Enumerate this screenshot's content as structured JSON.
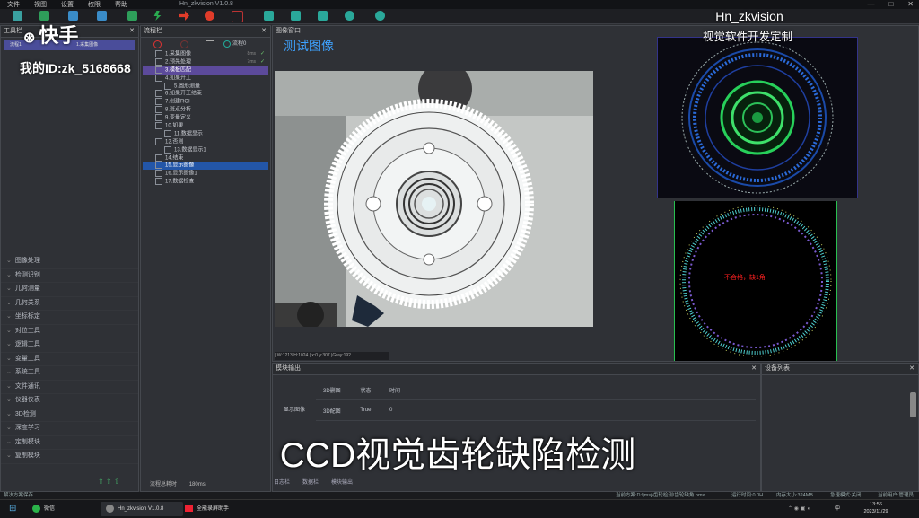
{
  "menubar": {
    "items": [
      "文件",
      "视图",
      "设置",
      "权限",
      "帮助"
    ],
    "title": "Hn_zkvision V1.0.8",
    "controls": [
      "—",
      "□",
      "✕"
    ]
  },
  "watermark": {
    "logo_text": "快手",
    "user_id": "我的ID:zk_5168668",
    "brand": "Hn_zkvision",
    "tagline": "视觉软件开发定制"
  },
  "toolbox": {
    "title": "工具栏",
    "top_item": "流程1",
    "top_item_right": "1.采集图像",
    "categories": [
      "图像处理",
      "检测识别",
      "几何测量",
      "几何关系",
      "坐标标定",
      "对位工具",
      "逻辑工具",
      "变量工具",
      "系统工具",
      "文件通讯",
      "仪器仪表",
      "3D检测",
      "深度学习",
      "定制模块",
      "复制模块"
    ]
  },
  "flow": {
    "title": "流程栏",
    "flow_name": "流程0",
    "rows": [
      {
        "label": "1.采集图像",
        "time": "8ms",
        "check": "✓",
        "style": "",
        "indent": 0
      },
      {
        "label": "2.预先处理",
        "time": "7ms",
        "check": "✓",
        "style": "",
        "indent": 0
      },
      {
        "label": "3.模板匹配",
        "time": "",
        "check": "",
        "style": "sel-purple",
        "indent": 0
      },
      {
        "label": "4.如果开工",
        "time": "",
        "check": "",
        "style": "",
        "indent": 0
      },
      {
        "label": "5.圆形测量",
        "time": "",
        "check": "",
        "style": "",
        "indent": 1
      },
      {
        "label": "6.如果开工结束",
        "time": "",
        "check": "",
        "style": "",
        "indent": 0
      },
      {
        "label": "7.创建ROI",
        "time": "",
        "check": "",
        "style": "",
        "indent": 0
      },
      {
        "label": "8.斑点分析",
        "time": "",
        "check": "",
        "style": "",
        "indent": 0
      },
      {
        "label": "9.变量定义",
        "time": "",
        "check": "",
        "style": "",
        "indent": 0
      },
      {
        "label": "10.如果",
        "time": "",
        "check": "",
        "style": "",
        "indent": 0
      },
      {
        "label": "11.数据显示",
        "time": "",
        "check": "",
        "style": "",
        "indent": 1
      },
      {
        "label": "12.否则",
        "time": "",
        "check": "",
        "style": "",
        "indent": 0
      },
      {
        "label": "13.数据显示1",
        "time": "",
        "check": "",
        "style": "",
        "indent": 1
      },
      {
        "label": "14.结束",
        "time": "",
        "check": "",
        "style": "",
        "indent": 0
      },
      {
        "label": "15.显示图像",
        "time": "",
        "check": "",
        "style": "sel-blue",
        "indent": 0
      },
      {
        "label": "16.显示图像1",
        "time": "",
        "check": "",
        "style": "",
        "indent": 0
      },
      {
        "label": "17.数据检查",
        "time": "",
        "check": "",
        "style": "",
        "indent": 0
      }
    ],
    "total_label": "流程总耗时",
    "total_value": "180ms"
  },
  "image_window": {
    "title": "图像窗口",
    "main_title": "测试图像",
    "status": "| W:1213 H:1024 | x:0 y:307 |Gray:192",
    "result_text": "不合格，缺1角"
  },
  "module_output": {
    "title": "模块输出",
    "row_label": "显示图像",
    "headers": [
      "3D删图",
      "状态",
      "时间"
    ],
    "row": [
      "3D配图",
      "True",
      "0"
    ],
    "tabs": [
      "日志栏",
      "数据栏",
      "模块输出"
    ]
  },
  "device_panel": {
    "title": "设备列表"
  },
  "app_status": {
    "left": "解决方案保存...",
    "path": "当前方案:D:\\jmsj\\齿轮检测\\齿轮缺角.hmx",
    "runtime": "运行时间:0.0H",
    "memory": "内存大小:324MB",
    "mode": "急速模式:关闭",
    "user": "当前用户:管理员"
  },
  "taskbar": {
    "items": [
      "微信",
      "Hn_zkvision V1.0.8",
      "全能录屏助手"
    ],
    "ime": "中",
    "time": "13:56",
    "date": "2023/11/29"
  },
  "caption": "CCD视觉齿轮缺陷检测",
  "colors": {
    "accent": "#3ea2ff",
    "select_purple": "#5c4a9b",
    "select_blue": "#2356a8",
    "fail_red": "#ff2020"
  }
}
